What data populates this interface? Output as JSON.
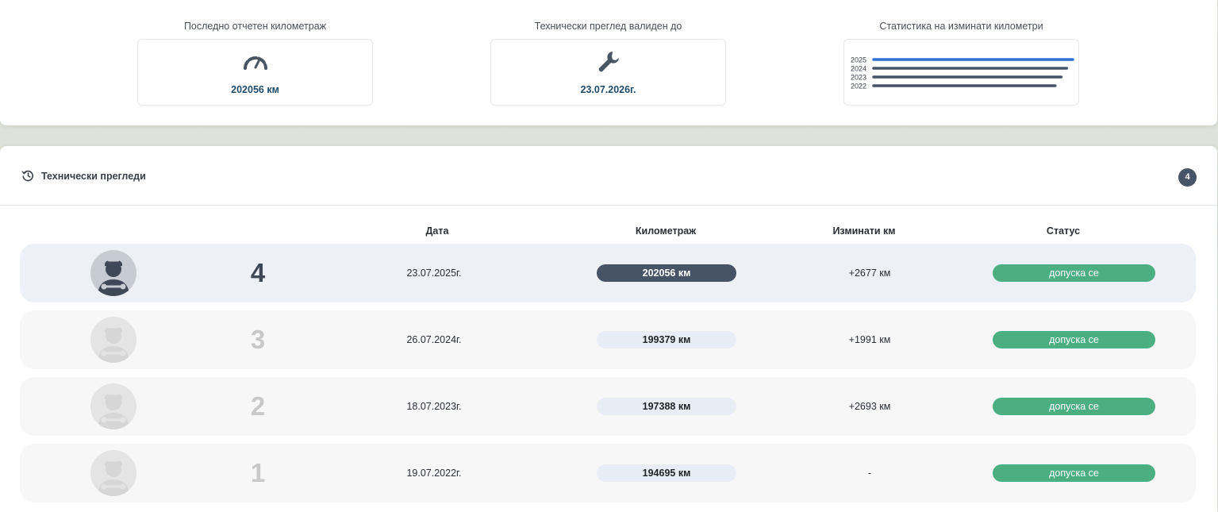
{
  "summary": {
    "last_mileage": {
      "label": "Последно отчетен километраж",
      "value": "202056 км",
      "icon": "speedometer-icon"
    },
    "inspection_valid": {
      "label": "Технически преглед валиден до",
      "value": "23.07.2026г.",
      "icon": "wrench-icon"
    },
    "stats": {
      "label": "Статистика на изминати километри"
    }
  },
  "chart_data": {
    "type": "bar",
    "orientation": "horizontal",
    "categories": [
      "2025",
      "2024",
      "2023",
      "2022"
    ],
    "values": [
      202056,
      199379,
      197388,
      194695
    ],
    "xlim": [
      0,
      202056
    ],
    "colors": [
      "#2f6fd1",
      "#475467",
      "#475467",
      "#475467"
    ]
  },
  "inspections": {
    "title": "Технически прегледи",
    "count": "4",
    "columns": {
      "date": "Дата",
      "mileage": "Километраж",
      "diff": "Изминати км",
      "status": "Статус"
    },
    "rows": [
      {
        "num": "4",
        "date": "23.07.2025г.",
        "mileage": "202056 км",
        "diff": "+2677 км",
        "status": "допуска се",
        "active": true
      },
      {
        "num": "3",
        "date": "26.07.2024г.",
        "mileage": "199379 км",
        "diff": "+1991 км",
        "status": "допуска се",
        "active": false
      },
      {
        "num": "2",
        "date": "18.07.2023г.",
        "mileage": "197388 км",
        "diff": "+2693 км",
        "status": "допуска се",
        "active": false
      },
      {
        "num": "1",
        "date": "19.07.2022г.",
        "mileage": "194695 км",
        "diff": "-",
        "status": "допуска се",
        "active": false
      }
    ]
  },
  "colors": {
    "accent": "#1e4c6e",
    "dark_pill": "#475467",
    "status_green": "#4caf82",
    "bar_current": "#2f6fd1"
  }
}
